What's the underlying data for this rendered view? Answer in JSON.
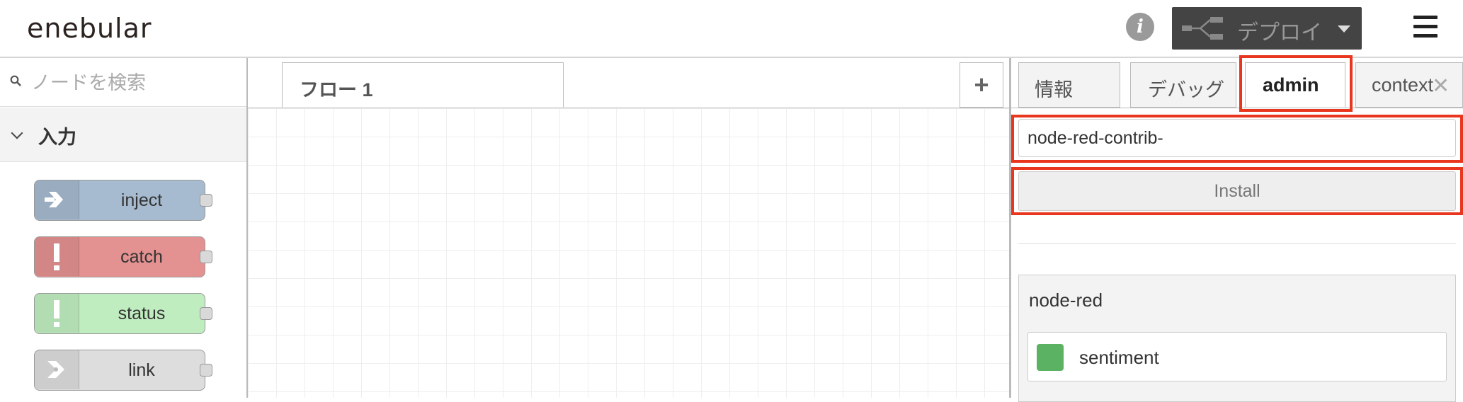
{
  "header": {
    "logo": "enebular",
    "deploy_label": "デプロイ",
    "icons": {
      "info": "info-icon",
      "deploy": "deploy-icon",
      "caret": "caret-down-icon",
      "menu": "hamburger-menu-icon"
    }
  },
  "palette": {
    "search_placeholder": "ノードを検索",
    "category": "入力",
    "nodes": [
      {
        "label": "inject",
        "color": "#a6bbcf",
        "icon": "inject-arrow-icon"
      },
      {
        "label": "catch",
        "color": "#e49191",
        "icon": "exclamation-icon"
      },
      {
        "label": "status",
        "color": "#c0edc0",
        "icon": "exclamation-icon"
      },
      {
        "label": "link",
        "color": "#dddddd",
        "icon": "link-arrow-icon"
      }
    ]
  },
  "workspace": {
    "tab_label": "フロー 1",
    "add_label": "+"
  },
  "sidebar": {
    "tabs": [
      "情報",
      "デバッグ",
      "admin",
      "context"
    ],
    "active_tab": "admin",
    "module_input": "node-red-contrib-",
    "install_label": "Install",
    "module_title": "node-red",
    "module_node": "sentiment",
    "highlight_color": "#e8361f"
  },
  "colors": {
    "node_sentiment": "#5bb262",
    "header_button": "#444444"
  }
}
